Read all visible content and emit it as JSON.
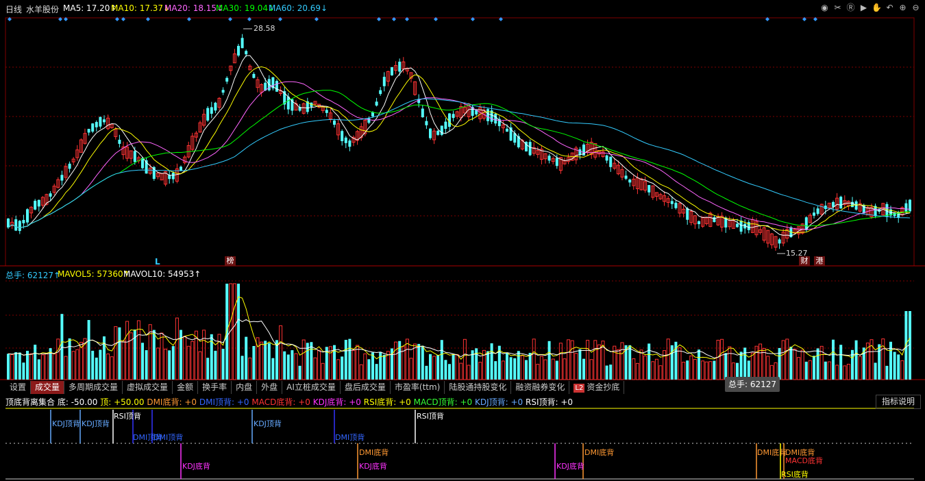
{
  "header": {
    "period": "日线",
    "stock_name": "水羊股份",
    "ma5": "MA5: 17.20↑",
    "ma10": "MA10: 17.37↓",
    "ma20": "MA20: 18.15↓",
    "ma30": "MA30: 19.04↓",
    "ma60": "MA60: 20.69↓"
  },
  "colors": {
    "ma5": "#ffffff",
    "ma10": "#ffff00",
    "ma20": "#ff66ff",
    "ma30": "#00ff00",
    "ma60": "#33ccff",
    "up": "#ff3333",
    "down": "#55ffff",
    "grid": "#800000",
    "diamond": "#3399ff"
  },
  "toolbar_icons": [
    "eye-icon",
    "scissors-icon",
    "replay-icon",
    "playback-icon",
    "hand-icon",
    "back-icon",
    "zoom-in-icon",
    "zoom-out-icon"
  ],
  "price_annotations": {
    "high": "28.58",
    "low": "15.27"
  },
  "markers": {
    "l": "L",
    "bang": "榜",
    "cai": "财",
    "gang": "港"
  },
  "volume_header": {
    "total": "总手: 62127↑",
    "mavol5": "MAVOL5: 57360↑",
    "mavol10": "MAVOL10: 54953↑"
  },
  "tabs": [
    {
      "label": "设置"
    },
    {
      "label": "成交量"
    },
    {
      "label": "多周期成交量"
    },
    {
      "label": "虚拟成交量"
    },
    {
      "label": "金额"
    },
    {
      "label": "换手率"
    },
    {
      "label": "内盘"
    },
    {
      "label": "外盘"
    },
    {
      "label": "AI立桩成交量"
    },
    {
      "label": "盘后成交量"
    },
    {
      "label": "市盈率(ttm)"
    },
    {
      "label": "陆股通持股变化"
    },
    {
      "label": "融资融券变化"
    },
    {
      "label": "资金抄底"
    }
  ],
  "l2_badge": "L2",
  "tooltip": "总手: 62127",
  "indicator_header": {
    "name": "顶底背离集合",
    "bottom": "底: -50.00",
    "top": "顶: +50.00",
    "dmi_bottom": "DMI底背: +0",
    "dmi_top": "DMI顶背: +0",
    "macd_bottom": "MACD底背: +0",
    "kdj_bottom": "KDJ底背: +0",
    "rsi_bottom": "RSI底背: +0",
    "macd_top": "MACD顶背: +0",
    "kdj_top": "KDJ顶背: +0",
    "rsi_top": "RSI顶背: +0"
  },
  "help_button": "指标说明",
  "signals": {
    "kdj_top": "KDJ顶背",
    "rsi_top": "RSI顶背",
    "dmi_top": "DMI顶背",
    "dmi_bottom": "DMI底背",
    "kdj_bottom": "KDJ底背",
    "macd_bottom": "MACD底背",
    "rsi_bottom": "RSI底背"
  },
  "chart_data": {
    "type": "candlestick",
    "stock": "水羊股份",
    "period": "日线",
    "highest_marked": 28.58,
    "lowest_marked": 15.27,
    "last_volume": 62127,
    "ma": {
      "MA5": 17.2,
      "MA10": 17.37,
      "MA20": 18.15,
      "MA30": 19.04,
      "MA60": 20.69
    },
    "mavol": {
      "MAVOL5": 57360,
      "MAVOL10": 54953
    }
  }
}
